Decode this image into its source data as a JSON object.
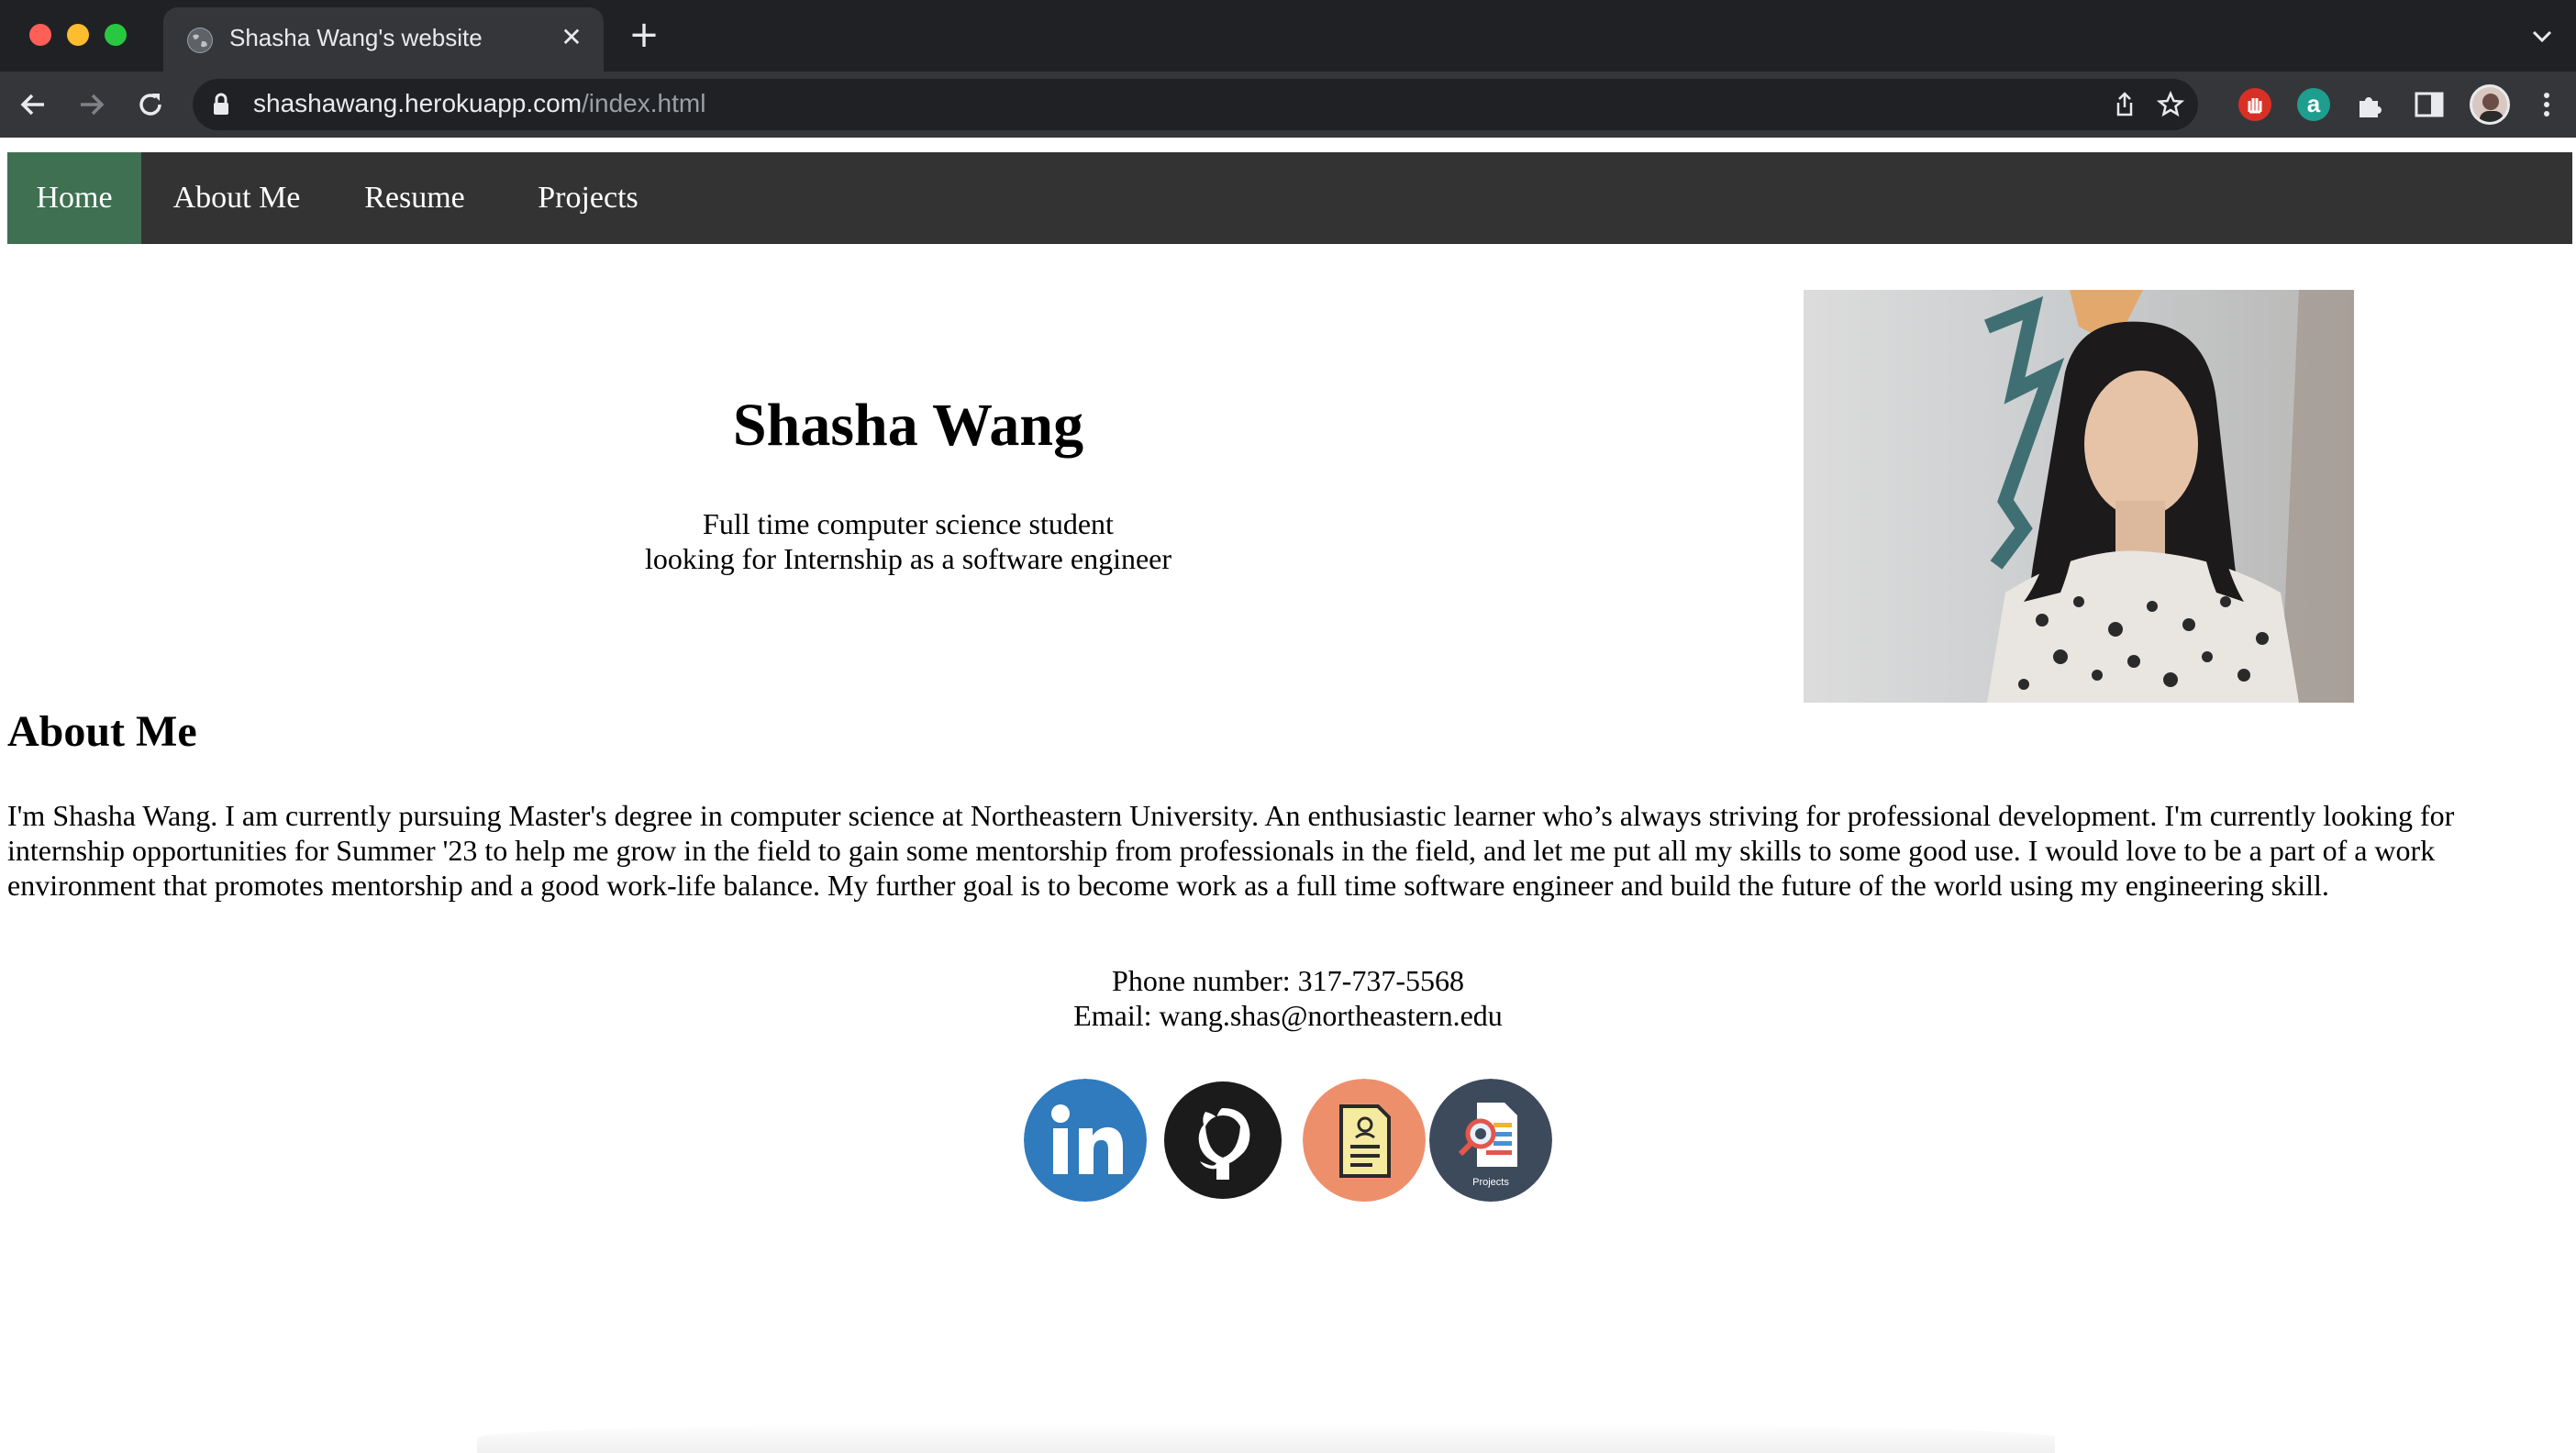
{
  "browser": {
    "tab_title": "Shasha Wang's website",
    "url_host": "shashawang.herokuapp.com",
    "url_path": "/index.html",
    "extension_label": "a"
  },
  "nav": {
    "items": [
      {
        "label": "Home",
        "active": true
      },
      {
        "label": "About Me",
        "active": false
      },
      {
        "label": "Resume",
        "active": false
      },
      {
        "label": "Projects",
        "active": false
      }
    ]
  },
  "hero": {
    "name": "Shasha Wang",
    "subtitle_line1": "Full time computer science student",
    "subtitle_line2": "looking for Internship as a software engineer"
  },
  "about": {
    "heading": "About Me",
    "body": "I'm Shasha Wang. I am currently pursuing Master's degree in computer science at Northeastern University. An enthusiastic learner who’s always striving for professional development. I'm currently looking for internship opportunities for Summer '23 to help me grow in the field to gain some mentorship from professionals in the field, and let me put all my skills to some good use. I would love to be a part of a work environment that promotes mentorship and a good work-life balance. My further goal is to become work as a full time software engineer and build the future of the world using my engineering skill."
  },
  "contact": {
    "phone": "Phone number: 317-737-5568",
    "email": "Email: wang.shas@northeastern.edu"
  },
  "social": {
    "projects_icon_label": "Projects"
  },
  "colors": {
    "nav_bg": "#333333",
    "nav_active": "#3f7052",
    "linkedin": "#2f7bbd",
    "github": "#1b1b1b",
    "resume": "#ee8f6c",
    "projects": "#3d4a5c"
  }
}
